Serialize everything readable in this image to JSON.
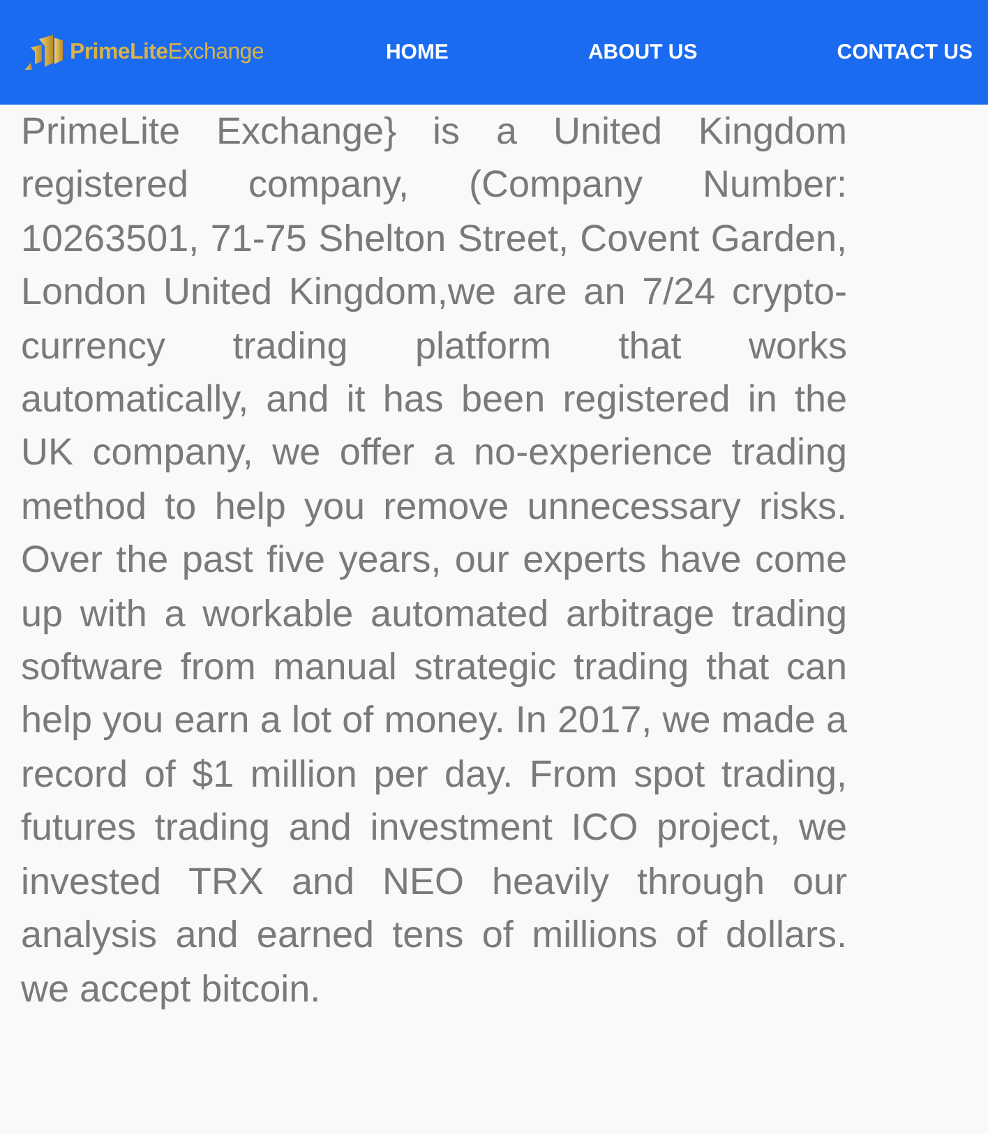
{
  "header": {
    "logo": "**PrimeLite**Exchange",
    "nav": [
      {
        "label": "HOME"
      },
      {
        "label": "ABOUT US"
      },
      {
        "label": "CONTACT US"
      }
    ]
  },
  "body": {
    "paragraph": "PrimeLite Exchange} is a United Kingdom registered company, (Company Number: 10263501, 71-75 Shelton Street, Covent Garden, London United Kingdom,we are an 7/24 crypto-currency trading platform that works automatically, and it has been registered in the UK company, we offer a no-experience trading method to help you remove unnecessary risks. Over the past five years, our experts have come up with a workable automated arbitrage trading software from manual strategic trading that can help you earn a lot of money. In 2017, we made a record of $1 million per day. From spot trading, futures trading and investment ICO project, we invested TRX and NEO heavily through our analysis and earned tens of millions of dollars. we accept bitcoin."
  }
}
